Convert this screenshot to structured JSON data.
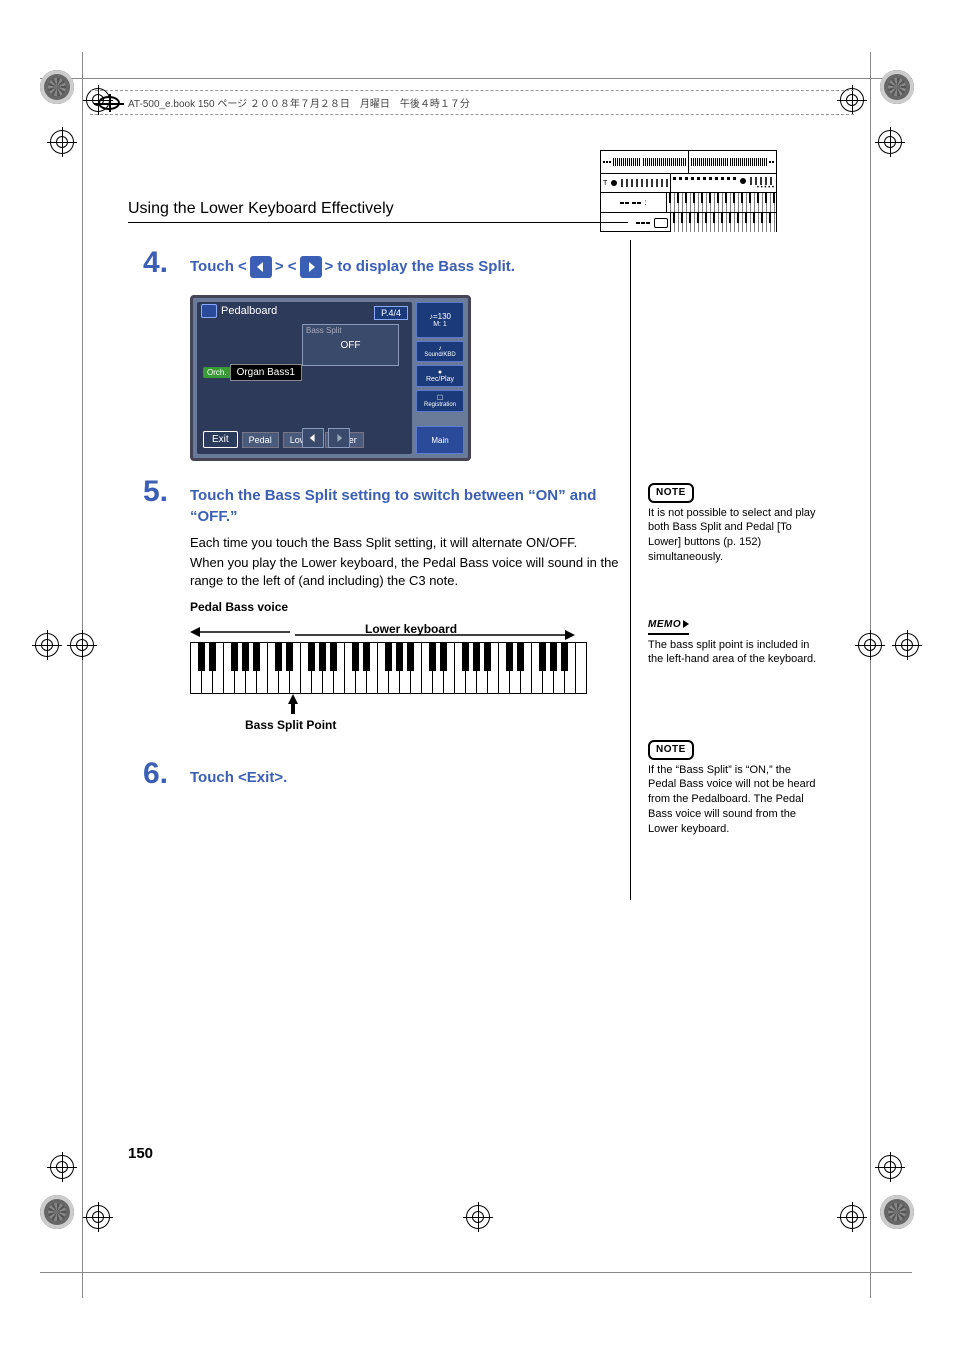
{
  "header": {
    "filename": "AT-500_e.book  150 ページ  ２００８年７月２８日　月曜日　午後４時１７分"
  },
  "section_title": "Using the Lower Keyboard Effectively",
  "steps": {
    "s4": {
      "num": "4.",
      "prefix": "Touch <",
      "mid": "> <",
      "suffix": "> to display the Bass Split."
    },
    "s5": {
      "num": "5.",
      "title": "Touch the Bass Split setting to switch between “ON” and “OFF.”",
      "body1": "Each time you touch the Bass Split setting, it will alternate ON/OFF.",
      "body2": "When you play the Lower keyboard, the Pedal Bass voice will sound in the range to the left of (and including) the C3 note."
    },
    "s6": {
      "num": "6.",
      "title": "Touch <Exit>."
    }
  },
  "screen": {
    "title": "Pedalboard",
    "page": "P.4/4",
    "voice_tag": "Orch.",
    "voice_name": "Organ Bass1",
    "setting_label": "Bass Split",
    "setting_value": "OFF",
    "exit": "Exit",
    "tab_pedal": "Pedal",
    "tab_lower": "Lower",
    "tab_upper": "Upper",
    "tempo_top": "♪=130",
    "tempo_bottom": "M:      1",
    "side_sound": "Sound/KBD",
    "side_rec": "Rec/Play",
    "side_reg": "Registration",
    "side_main": "Main"
  },
  "diagram": {
    "label_pedal": "Pedal Bass voice",
    "label_lower": "Lower keyboard",
    "label_split": "Bass Split Point"
  },
  "sidebar": {
    "note1_tag": "NOTE",
    "note1_text": "It is not possible to select and play both Bass Split and Pedal [To Lower] buttons (p. 152) simultaneously.",
    "memo_tag": "MEMO",
    "memo_text": "The bass split point is included in the left-hand area of the keyboard.",
    "note2_tag": "NOTE",
    "note2_text": "If the “Bass Split” is “ON,” the Pedal Bass voice will not be heard from the Pedalboard. The Pedal Bass voice will sound from the Lower keyboard."
  },
  "page_number": "150"
}
